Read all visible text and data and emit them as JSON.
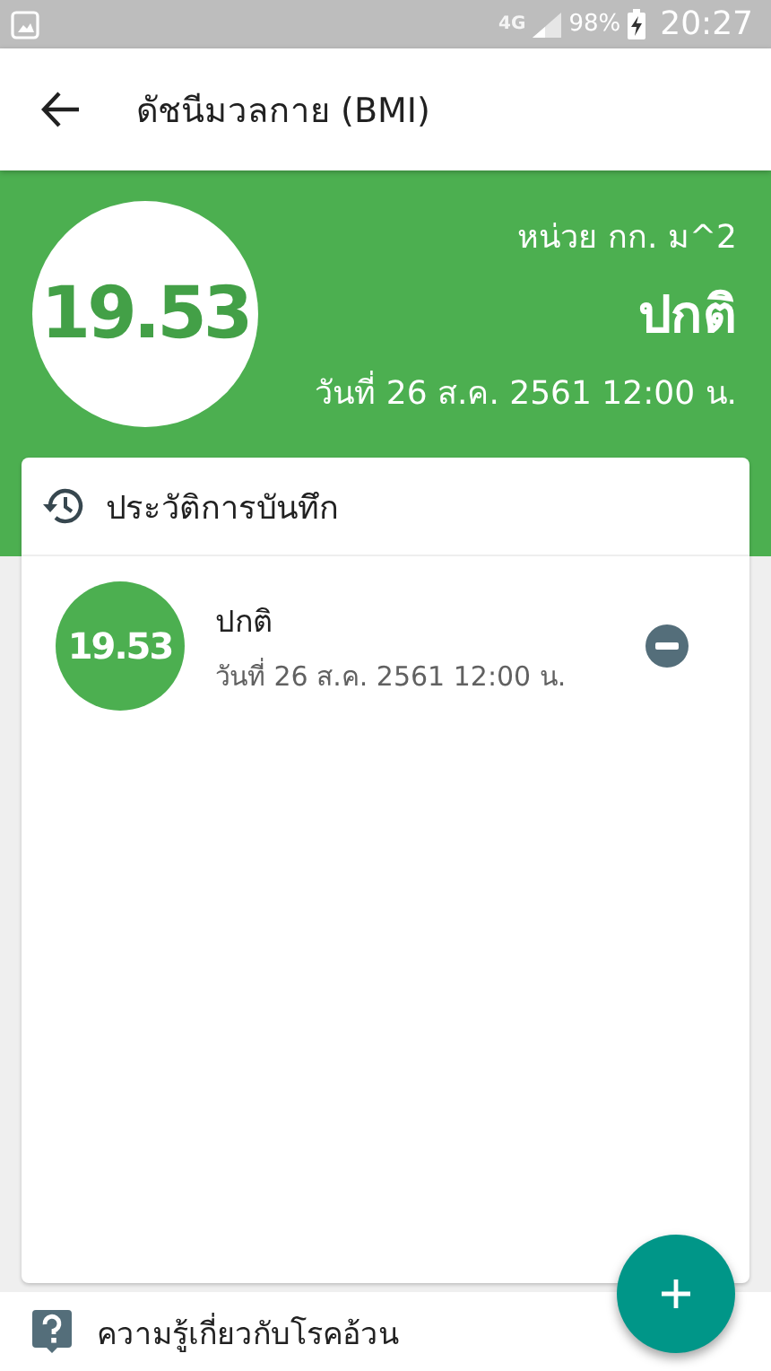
{
  "status_bar": {
    "network": "4G",
    "battery": "98%",
    "time": "20:27"
  },
  "app_bar": {
    "title": "ดัชนีมวลกาย (BMI)"
  },
  "summary": {
    "value": "19.53",
    "unit": "หน่วย กก. ม^2",
    "status": "ปกติ",
    "date": "วันที่ 26 ส.ค. 2561 12:00 น."
  },
  "history": {
    "title": "ประวัติการบันทึก",
    "entries": [
      {
        "value": "19.53",
        "status": "ปกติ",
        "date": "วันที่ 26 ส.ค. 2561 12:00 น."
      }
    ]
  },
  "footer": {
    "label": "ความรู้เกี่ยวกับโรคอ้วน"
  }
}
